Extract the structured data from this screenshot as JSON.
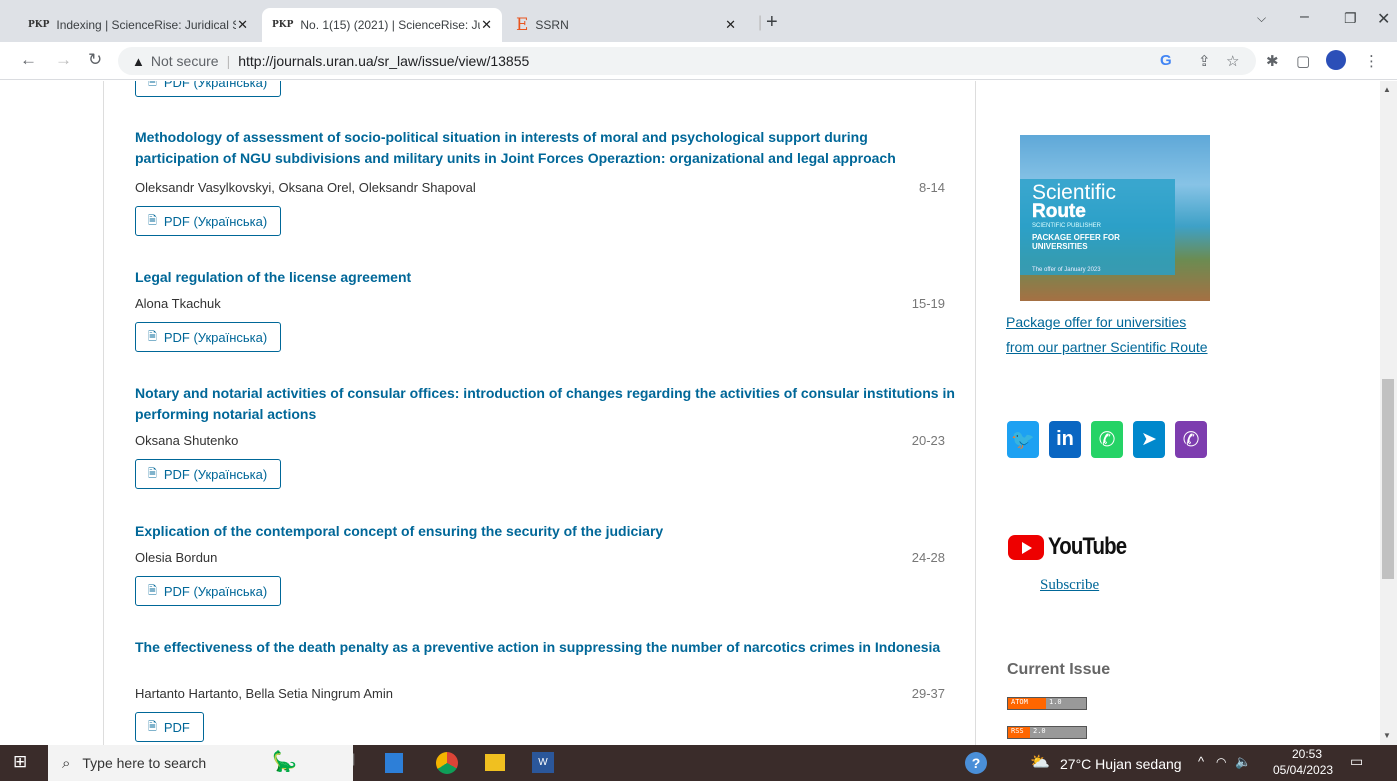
{
  "browser": {
    "tabs": [
      {
        "favicon": "PKP",
        "title": "Indexing | ScienceRise: Juridical S"
      },
      {
        "favicon": "PKP",
        "title": "No. 1(15) (2021) | ScienceRise: Ju"
      },
      {
        "favicon": "E",
        "title": "SSRN"
      }
    ],
    "url_security": "Not secure",
    "url": "http://journals.uran.ua/sr_law/issue/view/13855"
  },
  "articles": [
    {
      "title": "Methodology of assessment of socio-political situation in interests of moral and psychological support during participation of NGU subdivisions and military units in Joint Forces Operaztion: organizational and legal approach",
      "authors": "Oleksandr Vasylkovskyi, Oksana Orel, Oleksandr Shapoval",
      "pages": "8-14",
      "pdf": "PDF (Українська)"
    },
    {
      "title": "Legal regulation of the license agreement",
      "authors": "Alona Tkachuk",
      "pages": "15-19",
      "pdf": "PDF (Українська)"
    },
    {
      "title": "Notary and notarial activities of consular offices: introduction of changes regarding the activities of consular institutions in performing notarial actions",
      "authors": "Oksana Shutenko",
      "pages": "20-23",
      "pdf": "PDF (Українська)"
    },
    {
      "title": "Explication of the contemporal concept of ensuring the security of the judiciary",
      "authors": "Olesia Bordun",
      "pages": "24-28",
      "pdf": "PDF (Українська)"
    },
    {
      "title": "The effectiveness of the death penalty as a preventive action in suppressing the number of narcotics crimes in Indonesia",
      "authors": "Hartanto Hartanto, Bella Setia Ningrum Amin",
      "pages": "29-37",
      "pdf": "PDF"
    }
  ],
  "top_pdf": "PDF (Українська)",
  "sidebar": {
    "promo": {
      "line1": "Scientific",
      "line2": "Route",
      "line3": "SCIENTIFIC PUBLISHER",
      "line4": "PACKAGE OFFER FOR UNIVERSITIES",
      "line5": "The offer of January 2023"
    },
    "promo_link_1": "Package offer for universities",
    "promo_link_2": "from our partner Scientific Route",
    "social_colors": {
      "twitter": "#1da1f2",
      "linkedin": "#0a66c2",
      "whatsapp": "#25d366",
      "telegram": "#0088cc",
      "viber": "#7d3daf"
    },
    "youtube_word": "YouTube",
    "subscribe": "Subscribe",
    "current_issue": "Current Issue",
    "feeds": [
      {
        "label": "ATOM",
        "version": "1.0"
      },
      {
        "label": "RSS",
        "version": "2.0"
      }
    ]
  },
  "taskbar": {
    "search_placeholder": "Type here to search",
    "weather": "27°C  Hujan sedang",
    "time": "20:53",
    "date": "05/04/2023"
  }
}
